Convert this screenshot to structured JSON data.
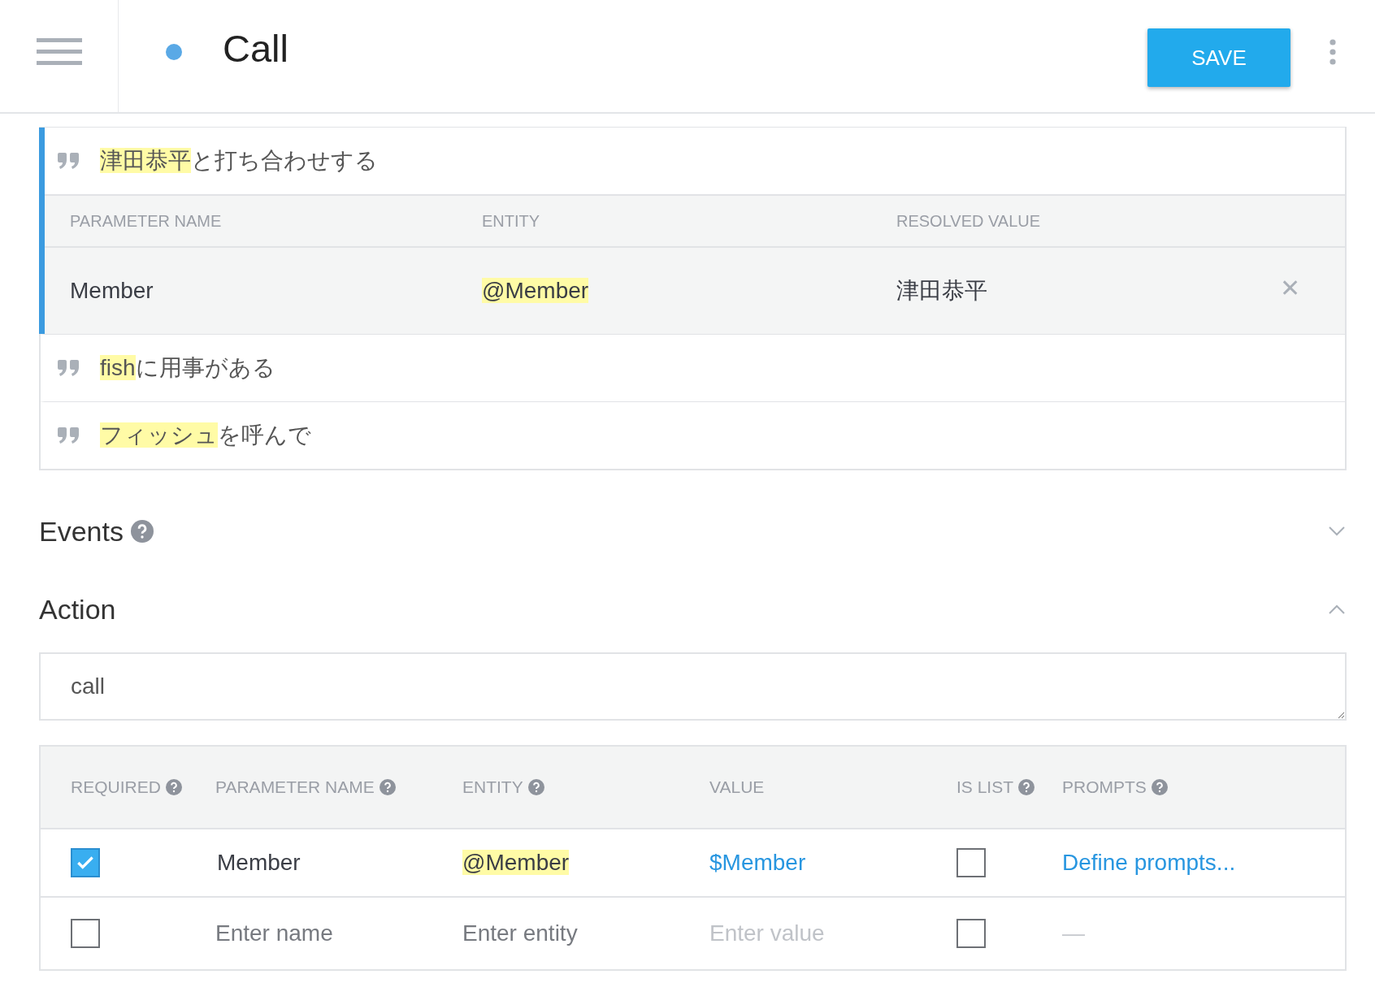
{
  "header": {
    "title": "Call",
    "save_button": "SAVE"
  },
  "training_phrases": [
    {
      "selected": true,
      "parts": [
        {
          "text": "津田恭平",
          "highlighted": true
        },
        {
          "text": "と打ち合わせする",
          "highlighted": false
        }
      ],
      "parameter_table": {
        "columns": [
          "PARAMETER NAME",
          "ENTITY",
          "RESOLVED VALUE"
        ],
        "rows": [
          {
            "name": "Member",
            "entity": "@Member",
            "entity_highlighted": true,
            "resolved_value": "津田恭平",
            "remove": "✕"
          }
        ]
      }
    },
    {
      "selected": false,
      "parts": [
        {
          "text": "fish",
          "highlighted": true
        },
        {
          "text": "に用事がある",
          "highlighted": false
        }
      ]
    },
    {
      "selected": false,
      "parts": [
        {
          "text": "フィッシュ",
          "highlighted": true
        },
        {
          "text": "を呼んで",
          "highlighted": false
        }
      ]
    }
  ],
  "sections": [
    {
      "title": "Events",
      "help": true,
      "expanded": false
    },
    {
      "title": "Action",
      "help": false,
      "expanded": true
    }
  ],
  "action": {
    "value": "call"
  },
  "parameters": {
    "columns": [
      {
        "label": "REQUIRED",
        "help": true
      },
      {
        "label": "PARAMETER NAME",
        "help": true
      },
      {
        "label": "ENTITY",
        "help": true
      },
      {
        "label": "VALUE",
        "help": false
      },
      {
        "label": "IS LIST",
        "help": true
      },
      {
        "label": "PROMPTS",
        "help": true
      }
    ],
    "rows": [
      {
        "kind": "parameter",
        "required": true,
        "name": "Member",
        "entity": "@Member",
        "entity_highlighted": true,
        "value": "$Member",
        "is_list": false,
        "prompts": "Define prompts...",
        "prompts_link": true
      },
      {
        "kind": "new",
        "required": false,
        "name_placeholder": "Enter name",
        "entity_placeholder": "Enter entity",
        "value_placeholder": "Enter value",
        "is_list": false,
        "prompts": "—",
        "prompts_link": false
      }
    ]
  }
}
